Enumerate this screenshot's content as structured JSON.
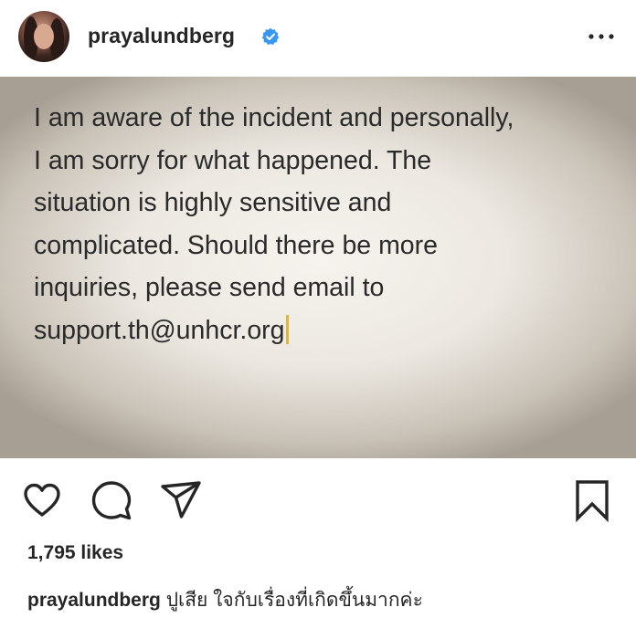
{
  "post": {
    "username": "prayalundberg",
    "verified_icon": "verified-badge-icon",
    "more_icon": "more-options-icon",
    "image_text_lines": [
      "I am aware of the incident and personally,",
      "I am sorry for what happened. The",
      "situation is highly sensitive and",
      "complicated. Should there be more",
      "inquiries, please send email to",
      "support.th@unhcr.org"
    ],
    "likes": "1,795 likes",
    "caption_username": "prayalundberg",
    "caption_text": "ปูเสีย ใจกับเรื่องที่เกิดขึ้นมากค่ะ"
  },
  "actions": {
    "like_icon": "heart-icon",
    "comment_icon": "comment-icon",
    "share_icon": "share-icon",
    "save_icon": "bookmark-icon"
  },
  "colors": {
    "verified": "#3897f0",
    "text": "#262626",
    "cursor": "#e0b73c"
  }
}
